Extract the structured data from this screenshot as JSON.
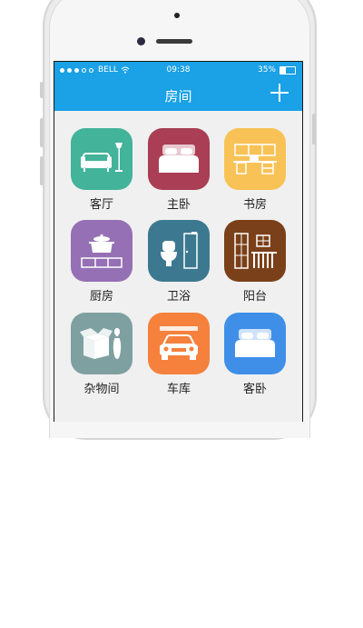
{
  "status_bar": {
    "carrier": "BELL",
    "time": "09:38",
    "battery": "35%"
  },
  "navbar": {
    "title": "房间",
    "add_icon": "plus-icon"
  },
  "rooms": [
    {
      "label": "客厅",
      "color": "#43b39a",
      "icon": "sofa-lamp-icon"
    },
    {
      "label": "主卧",
      "color": "#a93e55",
      "icon": "double-bed-icon"
    },
    {
      "label": "书房",
      "color": "#f8c256",
      "icon": "desk-shelf-icon"
    },
    {
      "label": "厨房",
      "color": "#9570b5",
      "icon": "rice-cooker-icon"
    },
    {
      "label": "卫浴",
      "color": "#3c7990",
      "icon": "toilet-door-icon"
    },
    {
      "label": "阳台",
      "color": "#7a4019",
      "icon": "balcony-door-icon"
    },
    {
      "label": "杂物间",
      "color": "#7fa0a0",
      "icon": "box-bowling-pin-icon"
    },
    {
      "label": "车库",
      "color": "#f5813d",
      "icon": "car-garage-icon"
    },
    {
      "label": "客卧",
      "color": "#3f8fe8",
      "icon": "guest-bed-icon"
    }
  ]
}
